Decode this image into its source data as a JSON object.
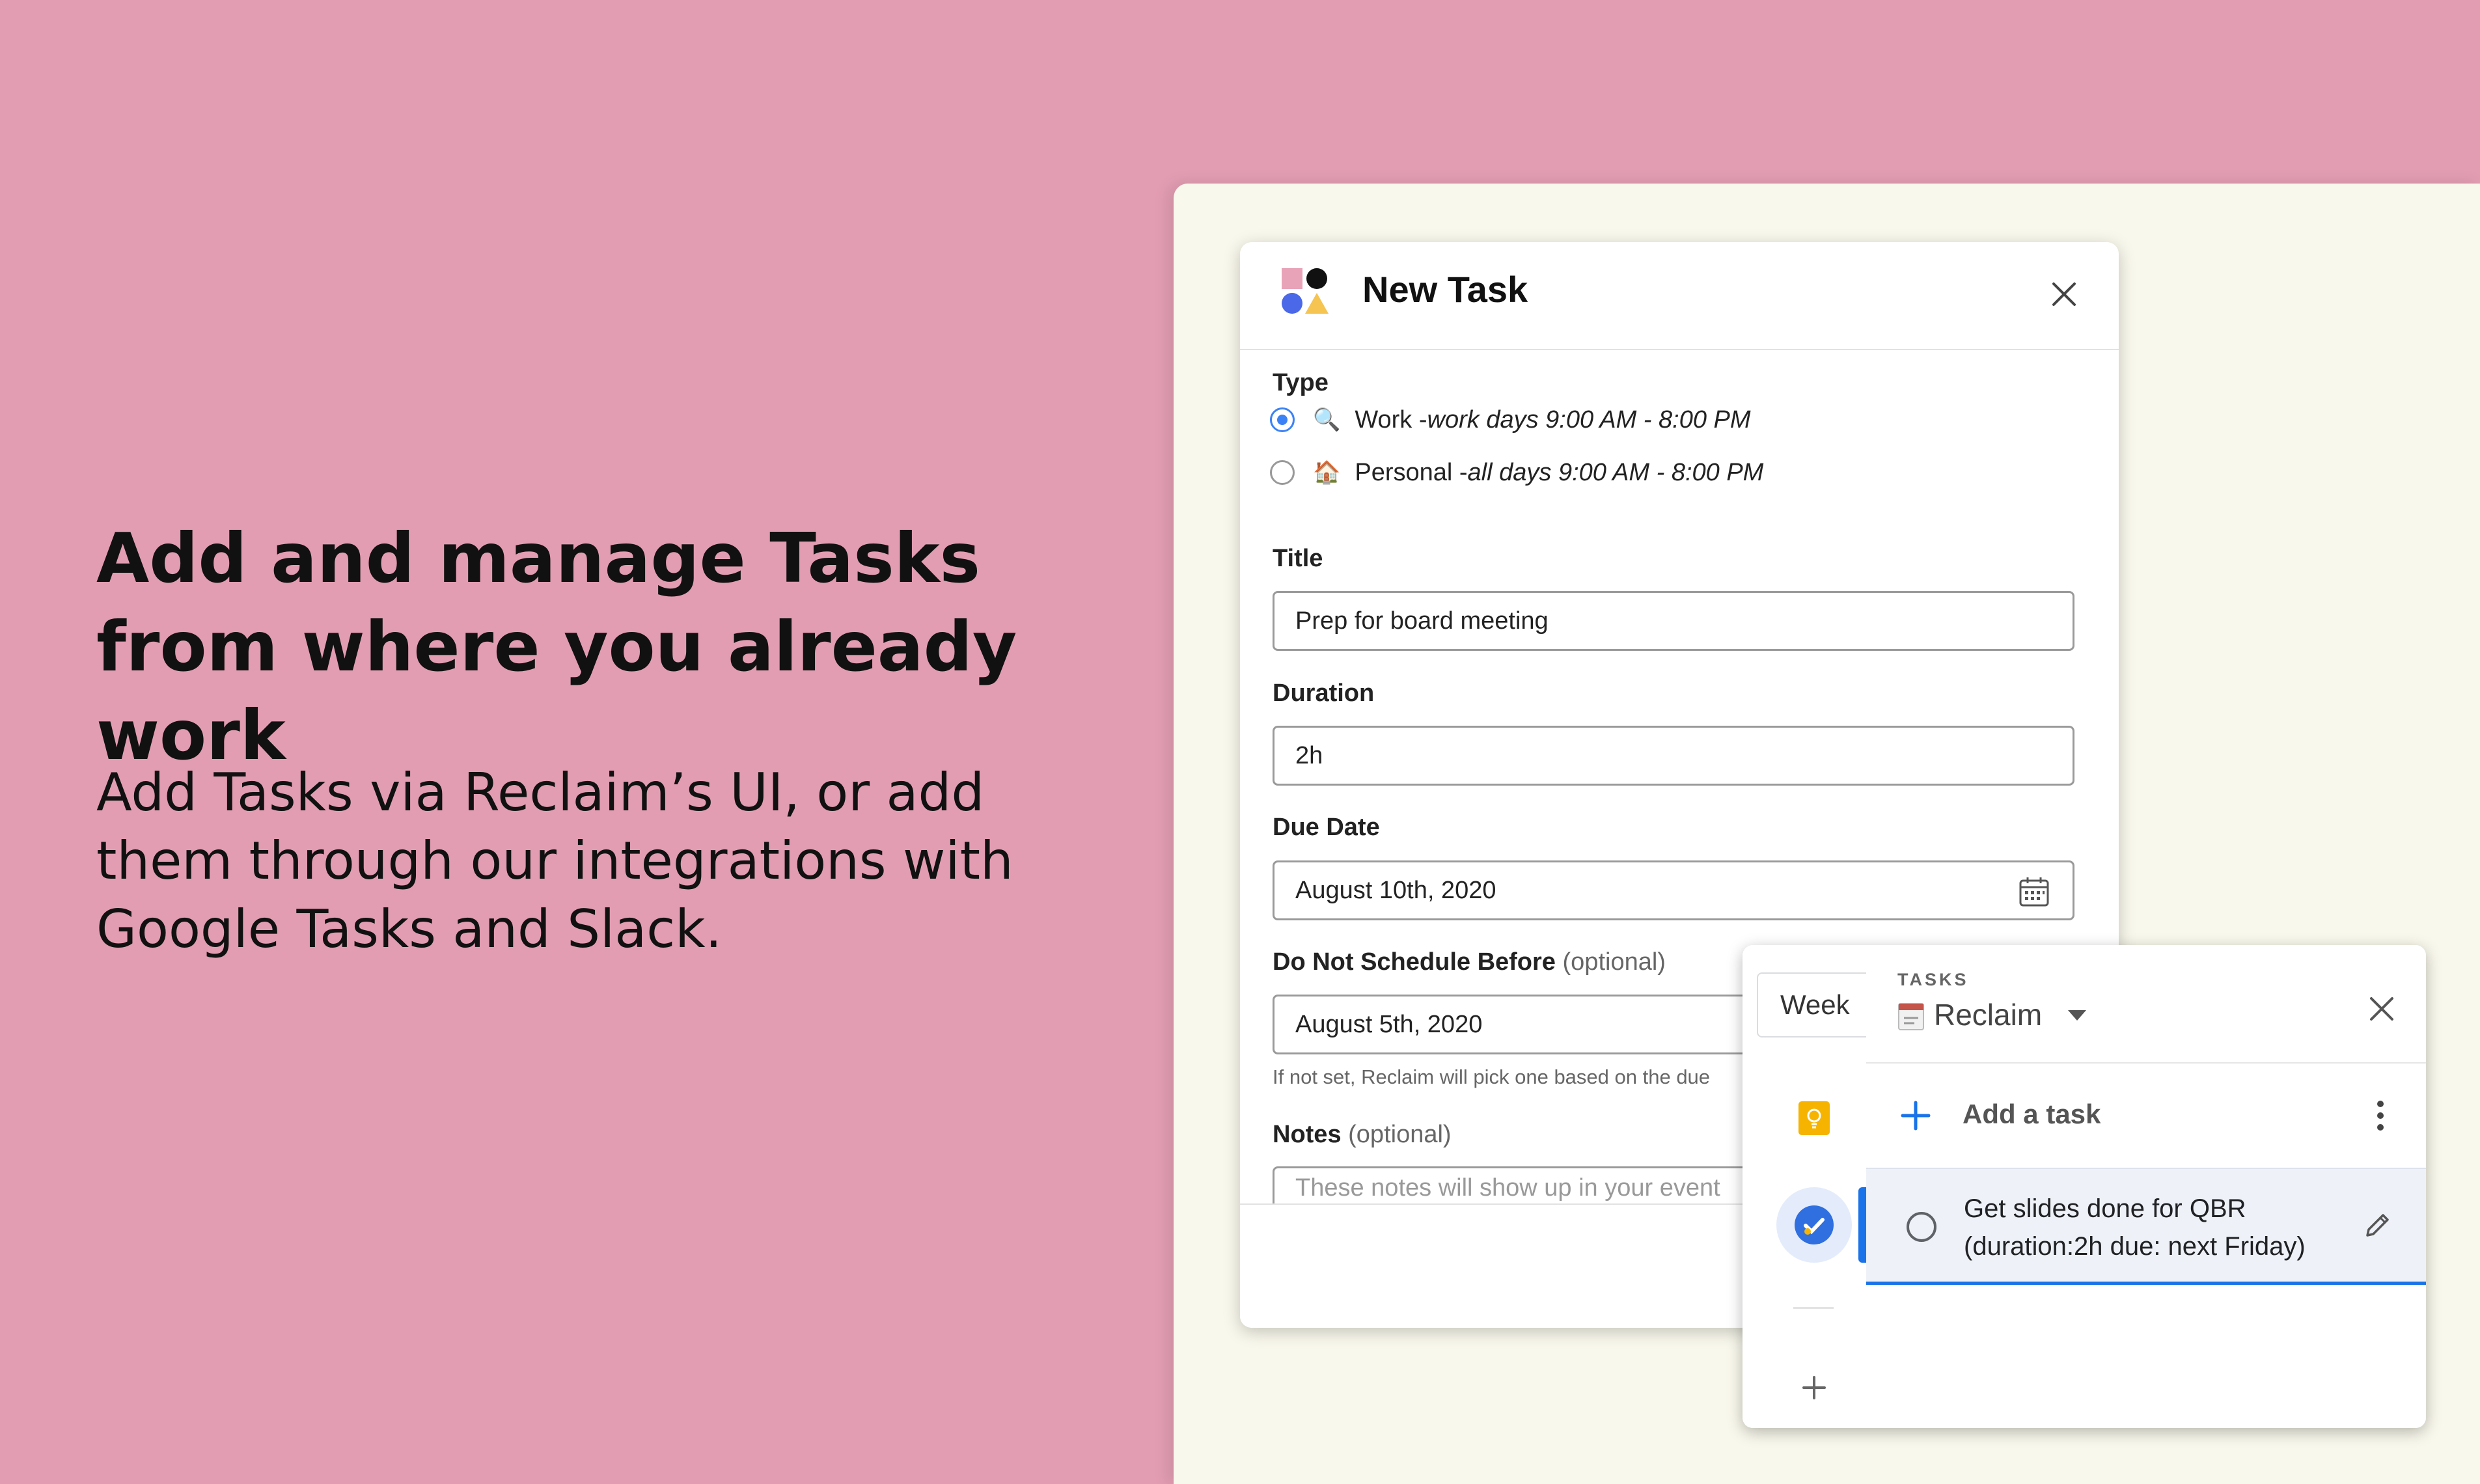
{
  "hero": {
    "headline": "Add and manage Tasks from where you already work",
    "subtext": "Add Tasks via Reclaim’s UI, or add them through our integrations with Google Tasks and Slack."
  },
  "dialog": {
    "title": "New Task",
    "type_label": "Type",
    "types": [
      {
        "emoji": "🔍",
        "name": "Work - ",
        "hours": "work days 9:00 AM - 8:00 PM",
        "selected": true
      },
      {
        "emoji": "🏠",
        "name": "Personal - ",
        "hours": "all days 9:00 AM - 8:00 PM",
        "selected": false
      }
    ],
    "title_label": "Title",
    "title_value": "Prep for board meeting",
    "duration_label": "Duration",
    "duration_value": "2h",
    "due_label": "Due Date",
    "due_value": "August 10th, 2020",
    "dnsb_label": "Do Not Schedule Before",
    "optional": "(optional)",
    "dnsb_value": "August 5th, 2020",
    "dnsb_hint": "If not set, Reclaim will pick one based on the due",
    "notes_label": "Notes",
    "notes_placeholder": "These notes will show up in your event"
  },
  "google_tasks": {
    "week_button": "Week",
    "header_label": "TASKS",
    "list_name": "Reclaim",
    "add_task": "Add a task",
    "task": {
      "line1": "Get slides done for QBR",
      "line2": "(duration:2h due: next Friday)"
    }
  },
  "colors": {
    "background": "#e29db2",
    "panel": "#f9f8ec",
    "accent_blue": "#1a73e8",
    "radio_blue": "#3b82f6"
  }
}
